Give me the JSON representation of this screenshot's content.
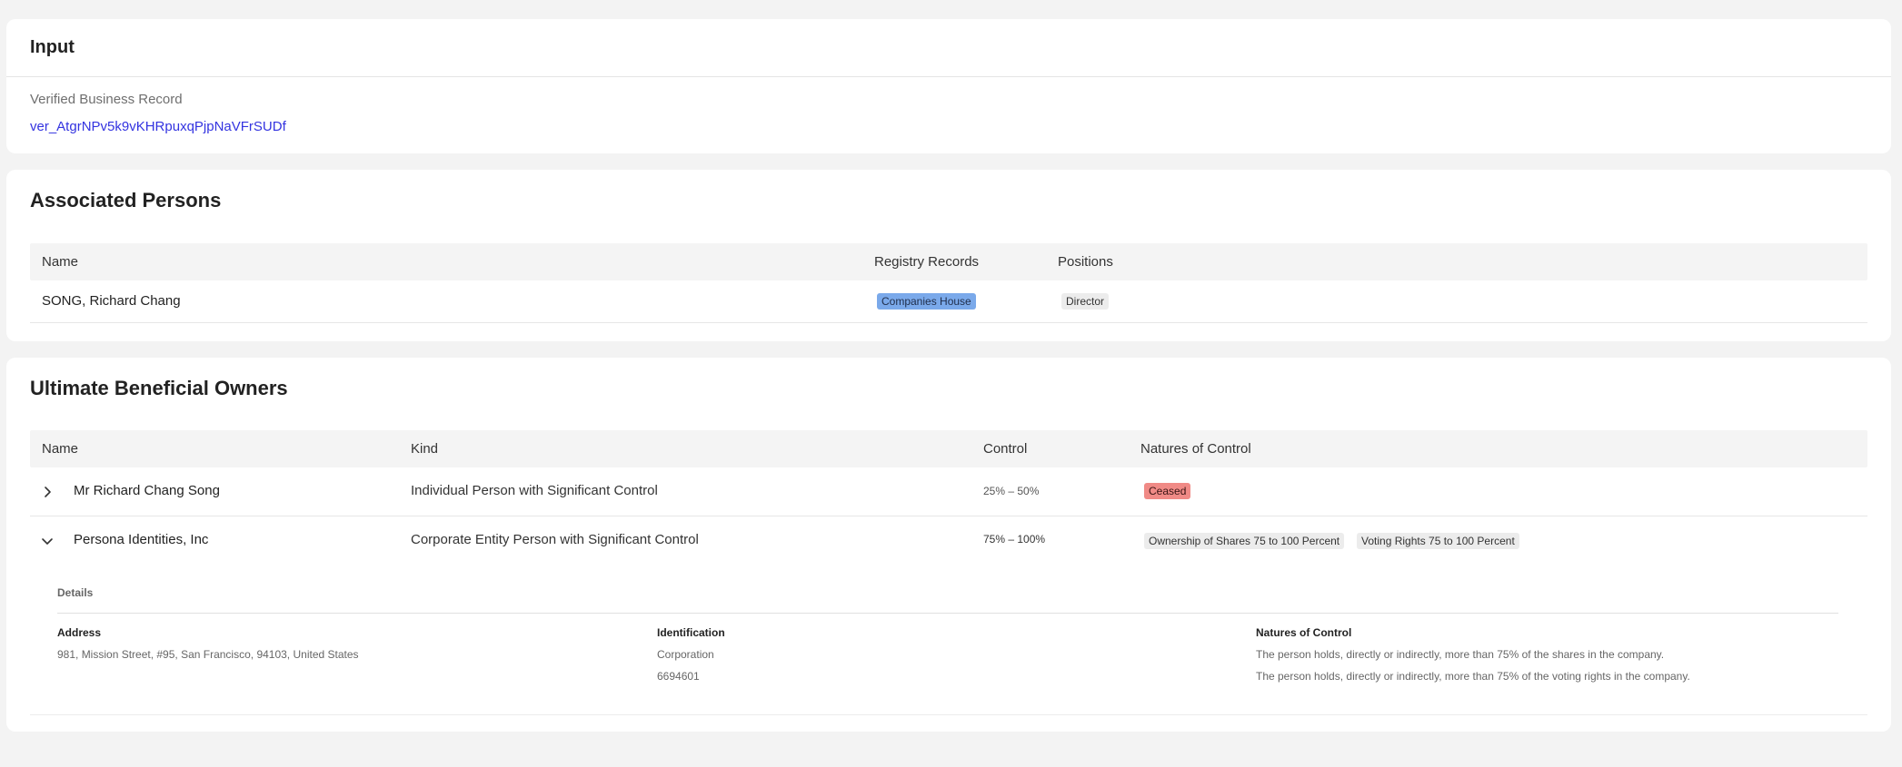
{
  "input": {
    "title": "Input",
    "field_label": "Verified Business Record",
    "field_value": "ver_AtgrNPv5k9vKHRpuxqPjpNaVFrSUDf"
  },
  "persons": {
    "title": "Associated Persons",
    "columns": [
      "Name",
      "Registry Records",
      "Positions"
    ],
    "rows": [
      {
        "name": "SONG, Richard Chang",
        "registry": "Companies House",
        "position": "Director"
      }
    ]
  },
  "ubo": {
    "title": "Ultimate Beneficial Owners",
    "columns": [
      "Name",
      "Kind",
      "Control",
      "Natures of Control"
    ],
    "rows": [
      {
        "name": "Mr Richard Chang Song",
        "kind": "Individual Person with Significant Control",
        "control": "25% – 50%",
        "natures": [
          "Ceased"
        ],
        "expanded": false
      },
      {
        "name": "Persona Identities, Inc",
        "kind": "Corporate Entity Person with Significant Control",
        "control": "75% – 100%",
        "natures": [
          "Ownership of Shares 75 to 100 Percent",
          "Voting Rights 75 to 100 Percent"
        ],
        "expanded": true
      }
    ],
    "details": {
      "label": "Details",
      "address_title": "Address",
      "address": "981, Mission Street, #95, San Francisco, 94103, United States",
      "identification_title": "Identification",
      "identification_type": "Corporation",
      "identification_number": "6694601",
      "natures_title": "Natures of Control",
      "natures": [
        "The person holds, directly or indirectly, more than 75% of the shares in the company.",
        "The person holds, directly or indirectly, more than 75% of the voting rights in the company."
      ]
    }
  },
  "colors": {
    "link": "#3333e0",
    "registry_badge": "#7aa9ea",
    "ceased_badge": "#f08a86",
    "neutral_badge": "#ececec"
  },
  "icons": {
    "collapsed_row": "chevron-right-icon",
    "expanded_row": "chevron-down-icon"
  }
}
